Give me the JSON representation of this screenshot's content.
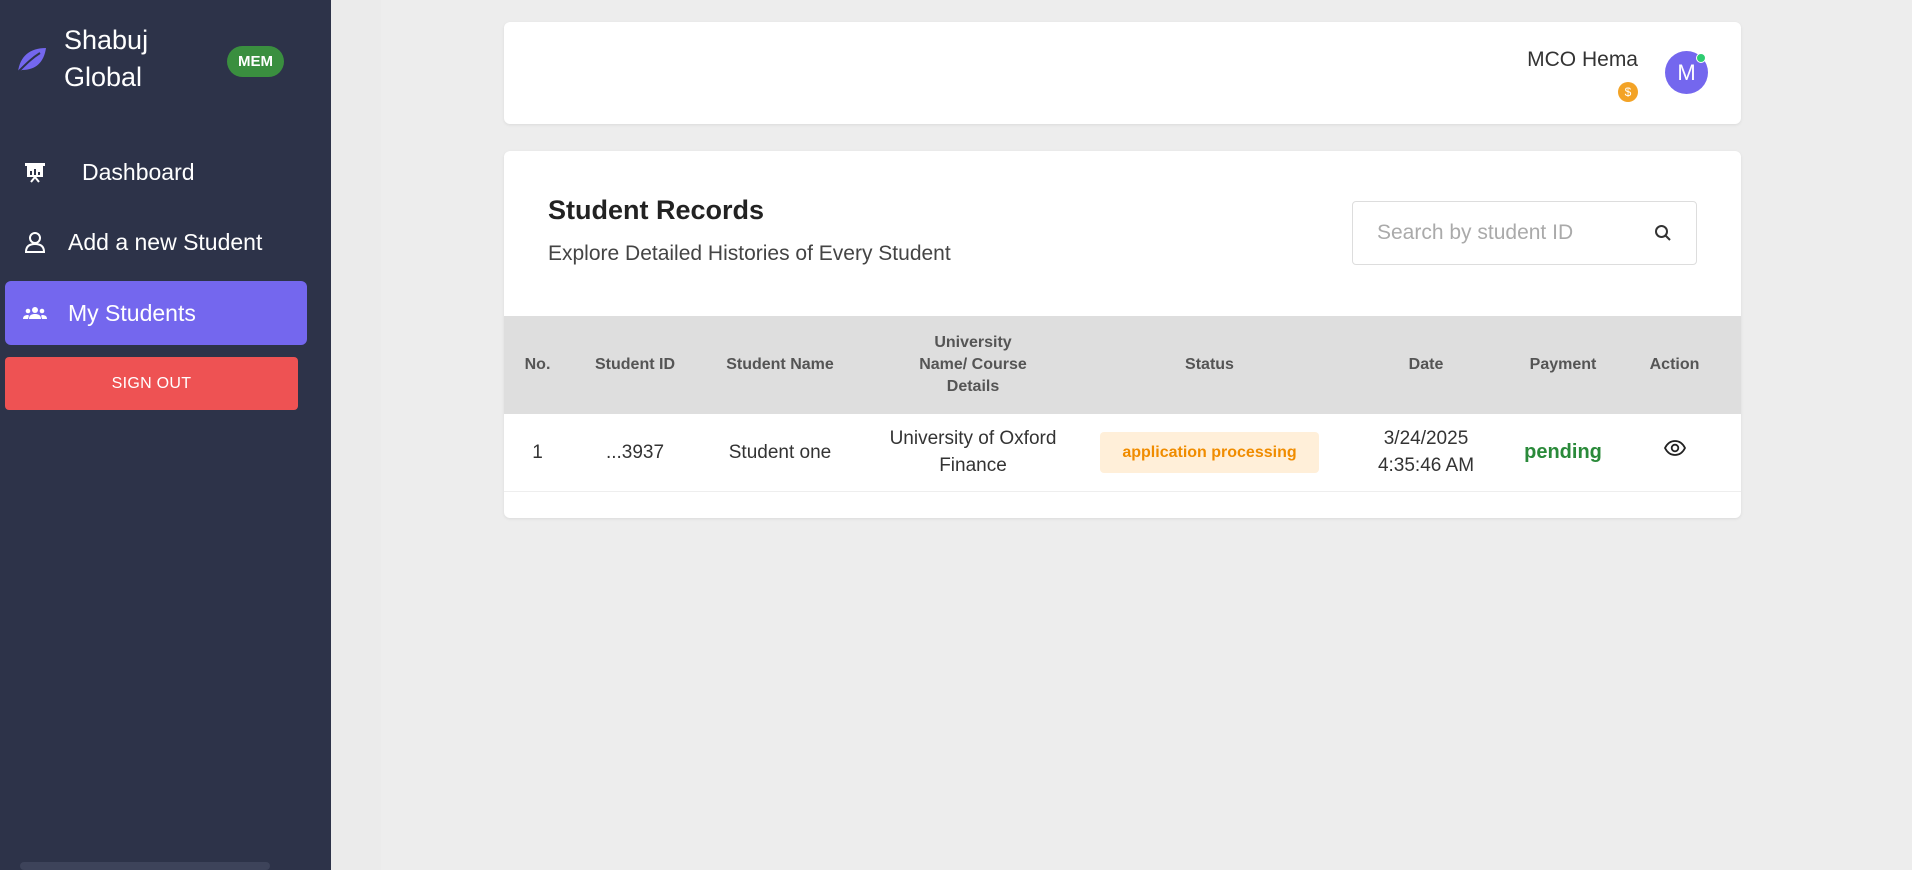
{
  "sidebar": {
    "brand": "Shabuj Global",
    "badge": "MEM",
    "items": [
      {
        "label": "Dashboard",
        "icon": "presentation-chart-icon"
      },
      {
        "label": "Add a new Student",
        "icon": "user-icon"
      },
      {
        "label": "My Students",
        "icon": "users-group-icon",
        "active": true
      }
    ],
    "signout": "SIGN OUT"
  },
  "header": {
    "user_name": "MCO Hema",
    "coin": "$",
    "avatar_initial": "M"
  },
  "main": {
    "title": "Student Records",
    "subtitle": "Explore Detailed Histories of Every Student",
    "search": {
      "placeholder": "Search by student ID",
      "value": ""
    },
    "columns": [
      "No.",
      "Student ID",
      "Student Name",
      "University Name/ Course Details",
      "Status",
      "Date",
      "Payment",
      "Action"
    ],
    "rows": [
      {
        "no": "1",
        "student_id": "...3937",
        "student_name": "Student one",
        "university": "University of Oxford",
        "course": "Finance",
        "status": "application processing",
        "date": "3/24/2025",
        "time": "4:35:46 AM",
        "payment": "pending",
        "action_icon": "eye-icon"
      }
    ]
  },
  "colors": {
    "sidebar_bg": "#2d3349",
    "accent": "#7467ee",
    "signout": "#ee5253",
    "badge": "#3a8f3f",
    "status_text": "#f08c00",
    "payment_text": "#2a8a3a"
  }
}
